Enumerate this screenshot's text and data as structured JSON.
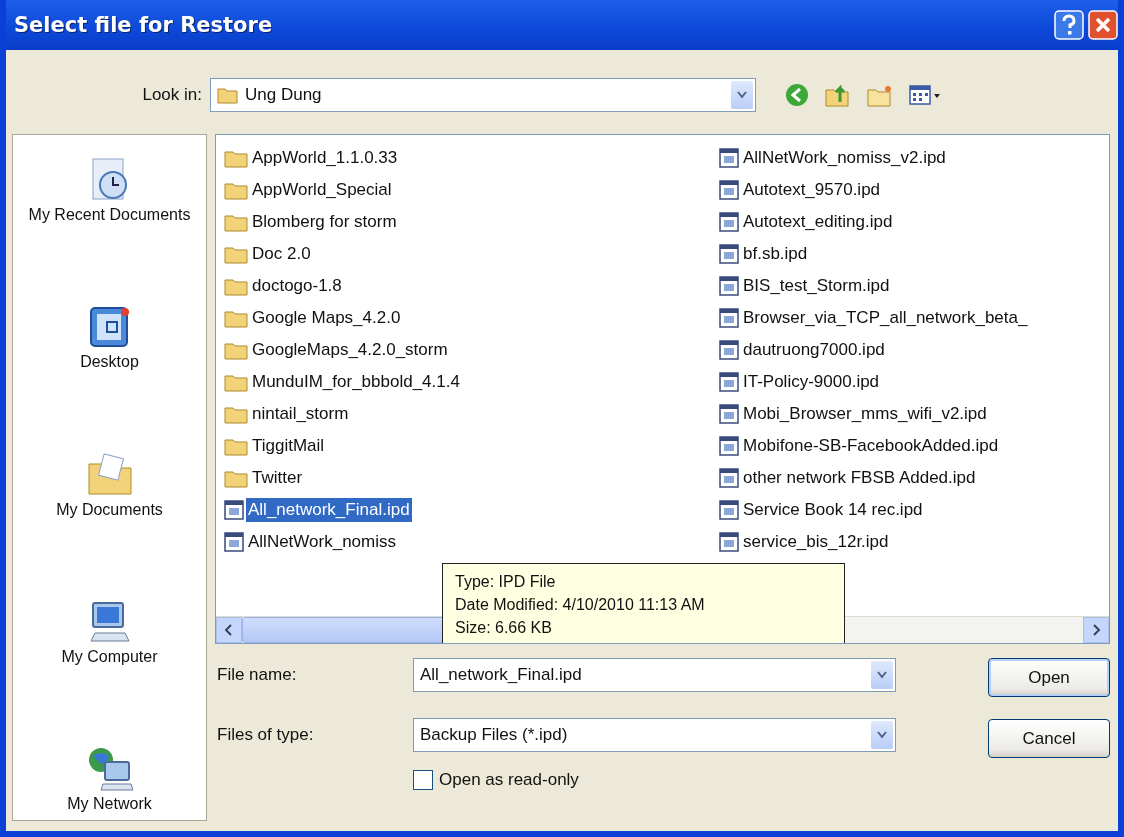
{
  "window": {
    "title": "Select file for Restore"
  },
  "look_in": {
    "label": "Look in:",
    "value": "Ung Dung"
  },
  "places": [
    {
      "kind": "recent",
      "label": "My Recent Documents"
    },
    {
      "kind": "desktop",
      "label": "Desktop"
    },
    {
      "kind": "documents",
      "label": "My Documents"
    },
    {
      "kind": "computer",
      "label": "My Computer"
    },
    {
      "kind": "network",
      "label": "My Network"
    }
  ],
  "files": [
    [
      {
        "kind": "folder",
        "name": "AppWorld_1.1.0.33",
        "selected": false
      },
      {
        "kind": "folder",
        "name": "AppWorld_Special",
        "selected": false
      },
      {
        "kind": "folder",
        "name": "Blomberg for storm",
        "selected": false
      },
      {
        "kind": "folder",
        "name": "Doc 2.0",
        "selected": false
      },
      {
        "kind": "folder",
        "name": "doctogo-1.8",
        "selected": false
      },
      {
        "kind": "folder",
        "name": "Google Maps_4.2.0",
        "selected": false
      },
      {
        "kind": "folder",
        "name": "GoogleMaps_4.2.0_storm",
        "selected": false
      },
      {
        "kind": "folder",
        "name": "MunduIM_for_bbbold_4.1.4",
        "selected": false
      },
      {
        "kind": "folder",
        "name": "nintail_storm",
        "selected": false
      },
      {
        "kind": "folder",
        "name": "TiggitMail",
        "selected": false
      },
      {
        "kind": "folder",
        "name": "Twitter",
        "selected": false
      },
      {
        "kind": "file",
        "name": "All_network_Final.ipd",
        "selected": true
      },
      {
        "kind": "file",
        "name": "AllNetWork_nomiss",
        "selected": false
      }
    ],
    [
      {
        "kind": "file",
        "name": "AllNetWork_nomiss_v2.ipd",
        "selected": false
      },
      {
        "kind": "file",
        "name": "Autotext_9570.ipd",
        "selected": false
      },
      {
        "kind": "file",
        "name": "Autotext_editing.ipd",
        "selected": false
      },
      {
        "kind": "file",
        "name": "bf.sb.ipd",
        "selected": false
      },
      {
        "kind": "file",
        "name": "BIS_test_Storm.ipd",
        "selected": false
      },
      {
        "kind": "file",
        "name": "Browser_via_TCP_all_network_beta_",
        "selected": false
      },
      {
        "kind": "file",
        "name": "dautruong7000.ipd",
        "selected": false
      },
      {
        "kind": "file",
        "name": "IT-Policy-9000.ipd",
        "selected": false
      },
      {
        "kind": "file",
        "name": "Mobi_Browser_mms_wifi_v2.ipd",
        "selected": false
      },
      {
        "kind": "file",
        "name": "Mobifone-SB-FacebookAdded.ipd",
        "selected": false
      },
      {
        "kind": "file",
        "name": "other network FBSB Added.ipd",
        "selected": false
      },
      {
        "kind": "file",
        "name": "Service Book 14 rec.ipd",
        "selected": false
      },
      {
        "kind": "file",
        "name": "service_bis_12r.ipd",
        "selected": false
      }
    ]
  ],
  "tooltip": [
    "Type: IPD File",
    "Date Modified: 4/10/2010 11:13 AM",
    "Size: 6.66 KB"
  ],
  "file_name": {
    "label": "File name:",
    "value": "All_network_Final.ipd"
  },
  "file_type": {
    "label": "Files of type:",
    "value": "Backup Files (*.ipd)"
  },
  "read_only": {
    "label": "Open as read-only",
    "checked": false
  },
  "buttons": [
    "Open",
    "Cancel"
  ]
}
